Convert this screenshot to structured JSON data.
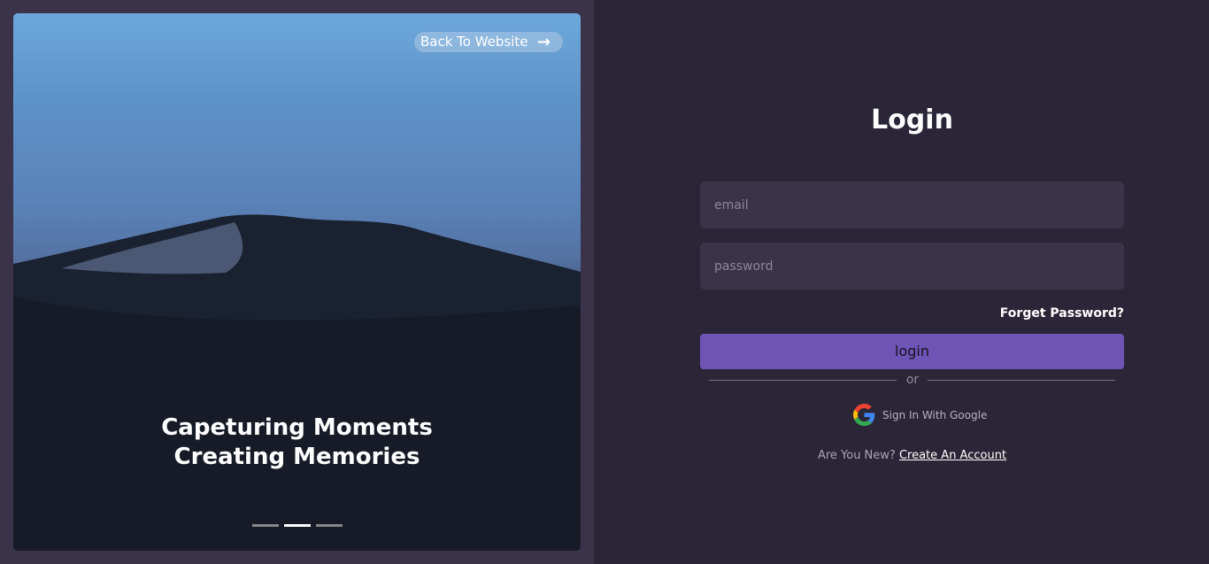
{
  "hero": {
    "back_label": "Back To Website",
    "caption_line1": "Capeturing Moments",
    "caption_line2": "Creating Memories",
    "slides": 3,
    "active_slide": 2
  },
  "form": {
    "title": "Login",
    "email_placeholder": "email",
    "password_placeholder": "password",
    "forget_label": "Forget Password?",
    "login_label": "login",
    "or_label": "or",
    "google_label": "Sign In With Google",
    "new_prompt": "Are You New?",
    "create_label": "Create An Account"
  },
  "colors": {
    "accent": "#6e54b5",
    "background": "#2b2637",
    "field": "#3b3449"
  },
  "icons": {
    "back": "arrow-right-icon",
    "google": "google-icon"
  }
}
